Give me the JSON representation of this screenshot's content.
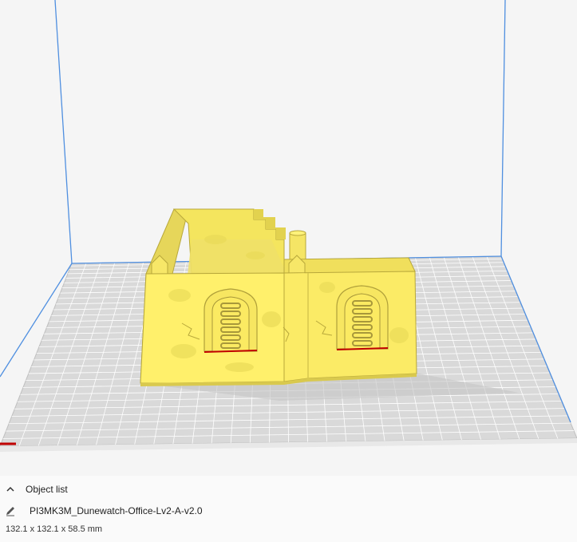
{
  "object_list": {
    "label": "Object list",
    "expanded": true,
    "chevron_icon": "chevron-up-icon"
  },
  "object": {
    "name": "PI3MK3M_Dunewatch-Office-Lv2-A-v2.0",
    "edit_icon": "pencil-icon",
    "dimensions": "132.1 x 132.1 x 58.5 mm"
  },
  "colors": {
    "model_fill": "#fff06b",
    "build_plate": "#d9d9d9",
    "volume_edges": "#4f8fe0",
    "plate_grid": "#ffffff"
  }
}
